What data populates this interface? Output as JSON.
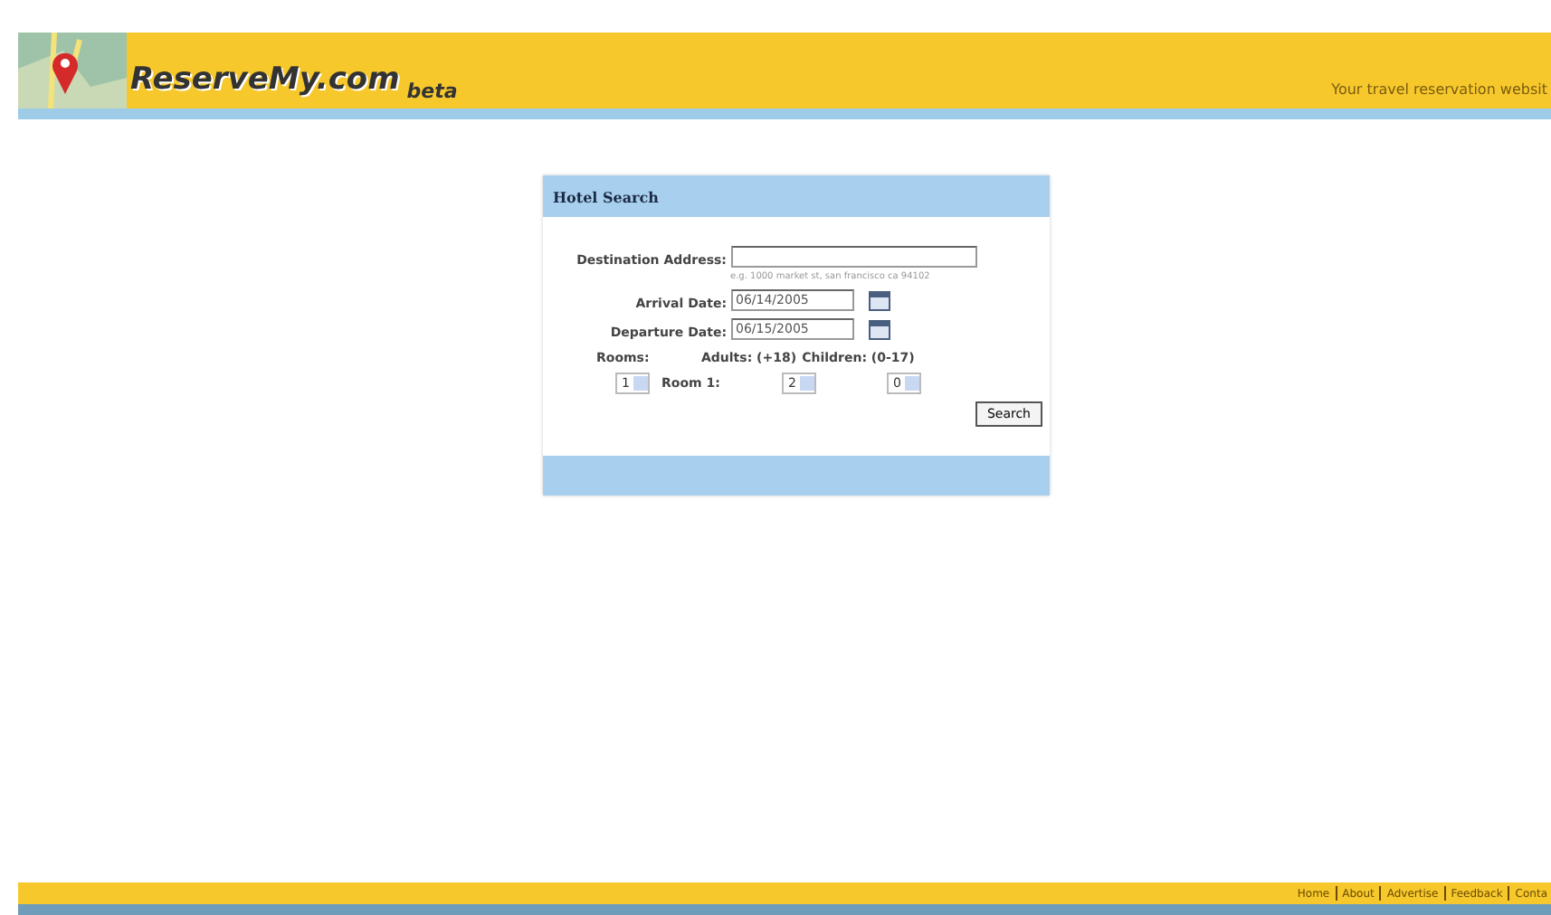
{
  "header": {
    "logo": "ReserveMy.com",
    "logo_suffix": "beta",
    "tagline": "Your travel reservation websit"
  },
  "panel": {
    "title": "Hotel Search",
    "destination": {
      "label": "Destination Address:",
      "hint": "e.g. 1000 market st, san francisco ca 94102"
    },
    "arrival": {
      "label": "Arrival Date:",
      "value": "06/14/2005"
    },
    "departure": {
      "label": "Departure Date:",
      "value": "06/15/2005"
    },
    "rooms_label": "Rooms:",
    "adults_label": "Adults: (+18)",
    "children_label": "Children: (0-17)",
    "rooms": "1",
    "room_row_label": "Room 1:",
    "adults": "2",
    "children": "0",
    "button": "Search"
  },
  "footer_links": [
    "Home",
    "About",
    "Advertise",
    "Feedback",
    "Conta"
  ]
}
